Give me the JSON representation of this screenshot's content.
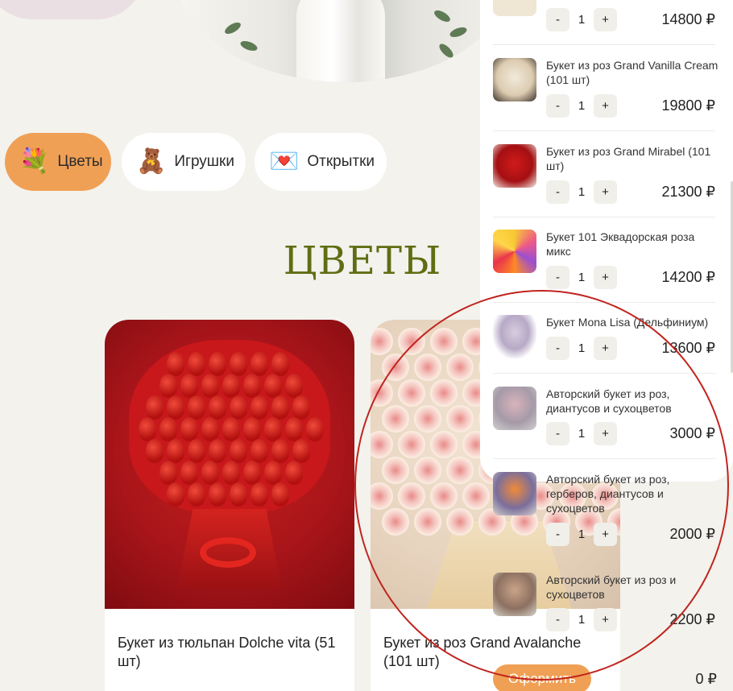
{
  "categories": [
    {
      "label": "Цветы",
      "icon": "bouquet-icon",
      "glyph": "💐",
      "active": true
    },
    {
      "label": "Игрушки",
      "icon": "teddy-bear-icon",
      "glyph": "🧸",
      "active": false
    },
    {
      "label": "Открытки",
      "icon": "greeting-card-icon",
      "glyph": "💌",
      "active": false
    }
  ],
  "section_title": "ЦВЕТЫ",
  "products": [
    {
      "name": "Букет из тюльпан Dolche vita (51 шт)"
    },
    {
      "name": "Букет из роз Grand Avalanche (101 шт)"
    }
  ],
  "cart": {
    "items": [
      {
        "title": "",
        "qty": "1",
        "price": "14800 ₽",
        "minus": "-",
        "plus": "+"
      },
      {
        "title": "Букет из роз Grand Vanilla Cream (101 шт)",
        "qty": "1",
        "price": "19800 ₽",
        "minus": "-",
        "plus": "+"
      },
      {
        "title": "Букет из роз Grand Mirabel (101 шт)",
        "qty": "1",
        "price": "21300 ₽",
        "minus": "-",
        "plus": "+"
      },
      {
        "title": "Букет 101 Эквадорская роза микс",
        "qty": "1",
        "price": "14200 ₽",
        "minus": "-",
        "plus": "+"
      },
      {
        "title": "Букет Mona Lisa (Дельфиниум)",
        "qty": "1",
        "price": "13600 ₽",
        "minus": "-",
        "plus": "+"
      },
      {
        "title": "Авторский букет из роз, диантусов и сухоцветов",
        "qty": "1",
        "price": "3000 ₽",
        "minus": "-",
        "plus": "+"
      },
      {
        "title": "Авторский букет из роз, герберов, диантусов и сухоцветов",
        "qty": "1",
        "price": "2000 ₽",
        "minus": "-",
        "plus": "+"
      },
      {
        "title": "Авторский букет из роз и сухоцветов",
        "qty": "1",
        "price": "2200 ₽",
        "minus": "-",
        "plus": "+"
      }
    ],
    "checkout_label": "Оформить",
    "total": "0 ₽"
  },
  "colors": {
    "accent": "#f0a055",
    "title_green": "#5e6e12",
    "annotation_red": "#c0241e"
  }
}
